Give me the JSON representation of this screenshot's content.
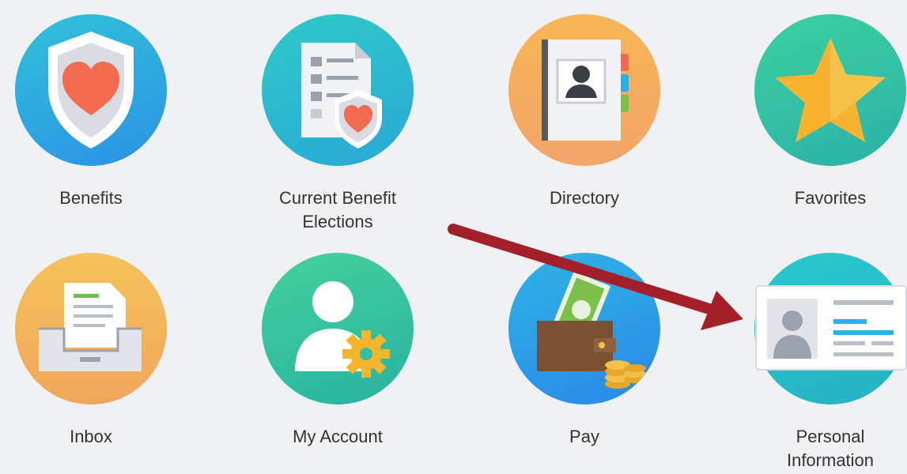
{
  "apps": [
    {
      "label": "Benefits",
      "icon": "shield-heart-icon"
    },
    {
      "label": "Current Benefit\nElections",
      "icon": "checklist-shield-icon"
    },
    {
      "label": "Directory",
      "icon": "address-book-icon"
    },
    {
      "label": "Favorites",
      "icon": "star-icon"
    },
    {
      "label": "Inbox",
      "icon": "inbox-tray-icon"
    },
    {
      "label": "My Account",
      "icon": "user-gear-icon"
    },
    {
      "label": "Pay",
      "icon": "wallet-money-icon"
    },
    {
      "label": "Personal\nInformation",
      "icon": "id-card-icon"
    }
  ],
  "annotation": {
    "icon": "red-arrow-icon",
    "color": "#a3202a"
  }
}
